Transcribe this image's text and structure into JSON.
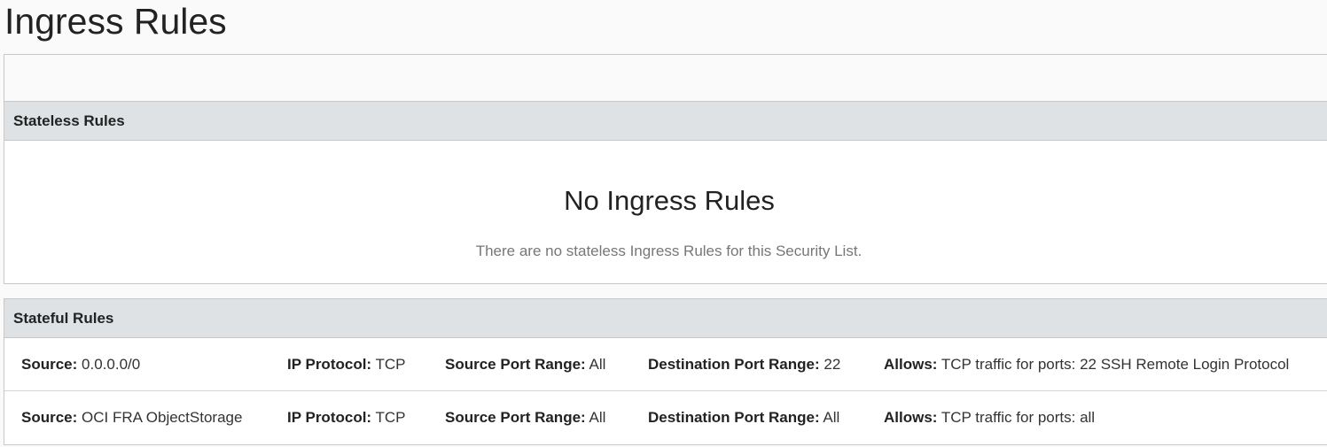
{
  "page": {
    "title": "Ingress Rules"
  },
  "stateless": {
    "header": "Stateless Rules",
    "empty_title": "No Ingress Rules",
    "empty_desc": "There are no stateless Ingress Rules for this Security List."
  },
  "stateful": {
    "header": "Stateful Rules",
    "labels": {
      "source": "Source:",
      "ip_protocol": "IP Protocol:",
      "source_port_range": "Source Port Range:",
      "destination_port_range": "Destination Port Range:",
      "allows": "Allows:"
    },
    "rules": [
      {
        "source": "0.0.0.0/0",
        "ip_protocol": "TCP",
        "source_port_range": "All",
        "destination_port_range": "22",
        "allows": "TCP traffic for ports: 22 SSH Remote Login Protocol"
      },
      {
        "source": "OCI FRA ObjectStorage",
        "ip_protocol": "TCP",
        "source_port_range": "All",
        "destination_port_range": "All",
        "allows": "TCP traffic for ports: all"
      }
    ]
  }
}
